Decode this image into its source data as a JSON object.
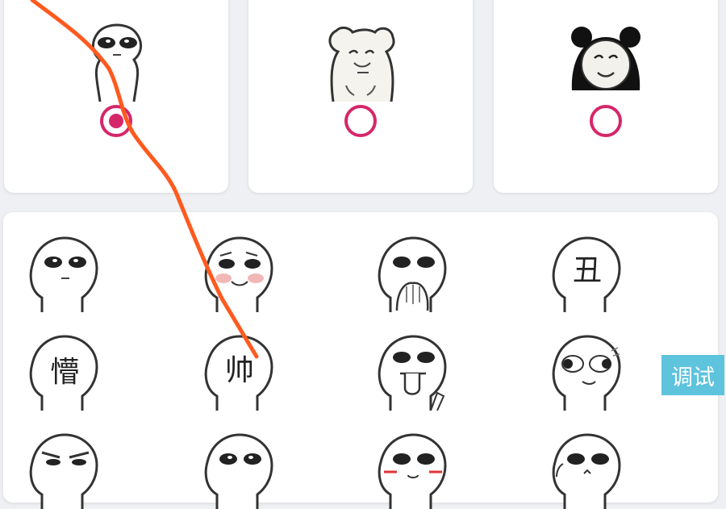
{
  "packs": [
    {
      "icon": "bald-doll-sticker-icon",
      "selected": true
    },
    {
      "icon": "bear-sticker-icon",
      "selected": false
    },
    {
      "icon": "panda-head-sticker-icon",
      "selected": false
    }
  ],
  "emoji_grid": {
    "items": [
      {
        "icon": "blank-stare-face-icon"
      },
      {
        "icon": "blushing-face-icon"
      },
      {
        "icon": "hands-over-mouth-face-icon"
      },
      {
        "icon": "chou-face-icon",
        "text": "丑"
      },
      {
        "icon": "meng-face-icon",
        "text": "懵"
      },
      {
        "icon": "shuai-face-icon",
        "text": "帅"
      },
      {
        "icon": "tongue-out-face-icon"
      },
      {
        "icon": "side-eye-face-icon"
      },
      {
        "icon": "smug-face-icon"
      },
      {
        "icon": "wide-eyed-face-icon"
      },
      {
        "icon": "blush-cheeks-face-icon"
      },
      {
        "icon": "worried-face-icon"
      }
    ]
  },
  "debug_button": {
    "label": "调试"
  },
  "colors": {
    "accent": "#d6266a",
    "debug_button_bg": "#5ec3dd",
    "annotation_stroke": "#ff5a1f"
  }
}
